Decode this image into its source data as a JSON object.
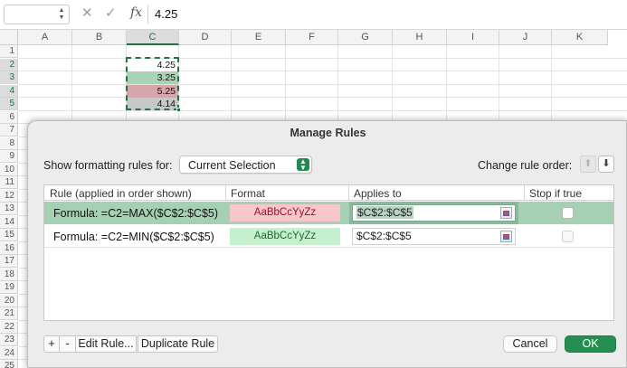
{
  "formula_bar": {
    "name_box_value": "",
    "cancel_glyph": "✕",
    "enter_glyph": "✓",
    "fx_label": "fx",
    "value": "4.25"
  },
  "grid": {
    "columns": [
      "A",
      "B",
      "C",
      "D",
      "E",
      "F",
      "G",
      "H",
      "I",
      "J",
      "K"
    ],
    "selected_column": "C",
    "rows": [
      "1",
      "2",
      "3",
      "4",
      "5",
      "6",
      "7",
      "8",
      "9",
      "10",
      "11",
      "12",
      "13",
      "14",
      "15",
      "16",
      "17",
      "18",
      "19",
      "20",
      "21",
      "22",
      "23",
      "24",
      "25"
    ],
    "cells": [
      {
        "row": 2,
        "value": "4.25",
        "fill": "#ffffff"
      },
      {
        "row": 3,
        "value": "3.25",
        "fill": "#a9d3b5"
      },
      {
        "row": 4,
        "value": "5.25",
        "fill": "#d9a5ac"
      },
      {
        "row": 5,
        "value": "4.14",
        "fill": "#c8c8c8"
      }
    ]
  },
  "dialog": {
    "title": "Manage Rules",
    "show_rules_label": "Show formatting rules for:",
    "scope_value": "Current Selection",
    "change_order_label": "Change rule order:",
    "columns": {
      "rule": "Rule (applied in order shown)",
      "format": "Format",
      "applies_to": "Applies to",
      "stop_if_true": "Stop if true"
    },
    "rules": [
      {
        "formula": "Formula: =C2=MAX($C$2:$C$5)",
        "format_preview": "AaBbCcYyZz",
        "format_bg": "#f8c7cd",
        "format_color": "#9c0b1f",
        "applies_to": "$C$2:$C$5",
        "stop_if_true": false,
        "selected": true
      },
      {
        "formula": "Formula: =C2=MIN($C$2:$C$5)",
        "format_preview": "AaBbCcYyZz",
        "format_bg": "#c6efce",
        "format_color": "#1e6b2e",
        "applies_to": "$C$2:$C$5",
        "stop_if_true": false,
        "selected": false
      }
    ],
    "buttons": {
      "add": "+",
      "remove": "-",
      "edit": "Edit Rule...",
      "duplicate": "Duplicate Rule",
      "cancel": "Cancel",
      "ok": "OK"
    },
    "accent_color": "#248f50"
  }
}
